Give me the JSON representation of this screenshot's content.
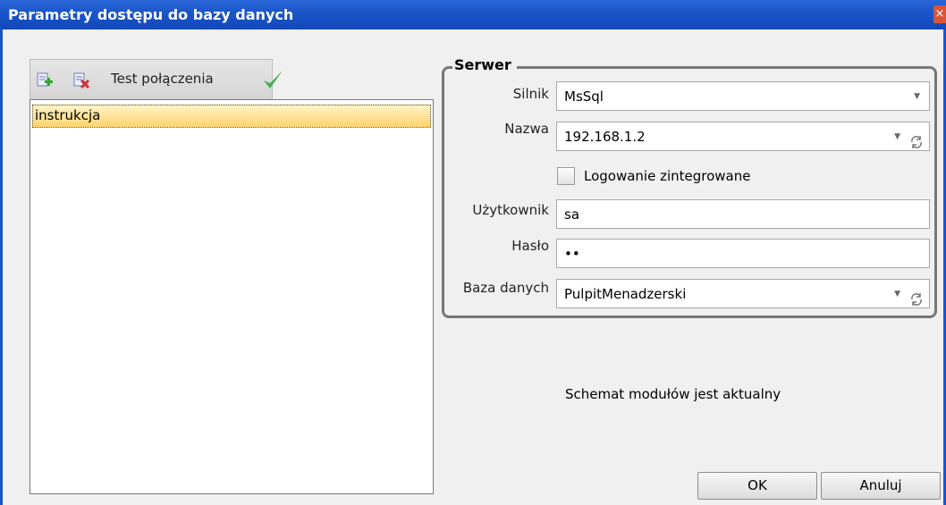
{
  "window": {
    "title": "Parametry dostępu do bazy danych",
    "close_glyph": "×"
  },
  "toolbar": {
    "add_icon": "add-db-icon",
    "delete_icon": "delete-db-icon",
    "test_label": "Test połączenia",
    "check_icon": "check-icon"
  },
  "connections": [
    {
      "label": "instrukcja"
    }
  ],
  "server": {
    "group_title": "Serwer",
    "engine_label": "Silnik",
    "engine_value": "MsSql",
    "name_label": "Nazwa",
    "name_value": "192.168.1.2",
    "integrated_login_label": "Logowanie zintegrowane",
    "integrated_login_checked": false,
    "user_label": "Użytkownik",
    "user_value": "sa",
    "password_label": "Hasło",
    "password_mask": "••",
    "database_label": "Baza danych",
    "database_value": "PulpitMenadzerski"
  },
  "status_text": "Schemat modułów jest aktualny",
  "buttons": {
    "ok": "OK",
    "cancel": "Anuluj"
  },
  "colors": {
    "title_bar": "#1a55c8",
    "selection": "#ffd36a",
    "check": "#4caf50"
  }
}
